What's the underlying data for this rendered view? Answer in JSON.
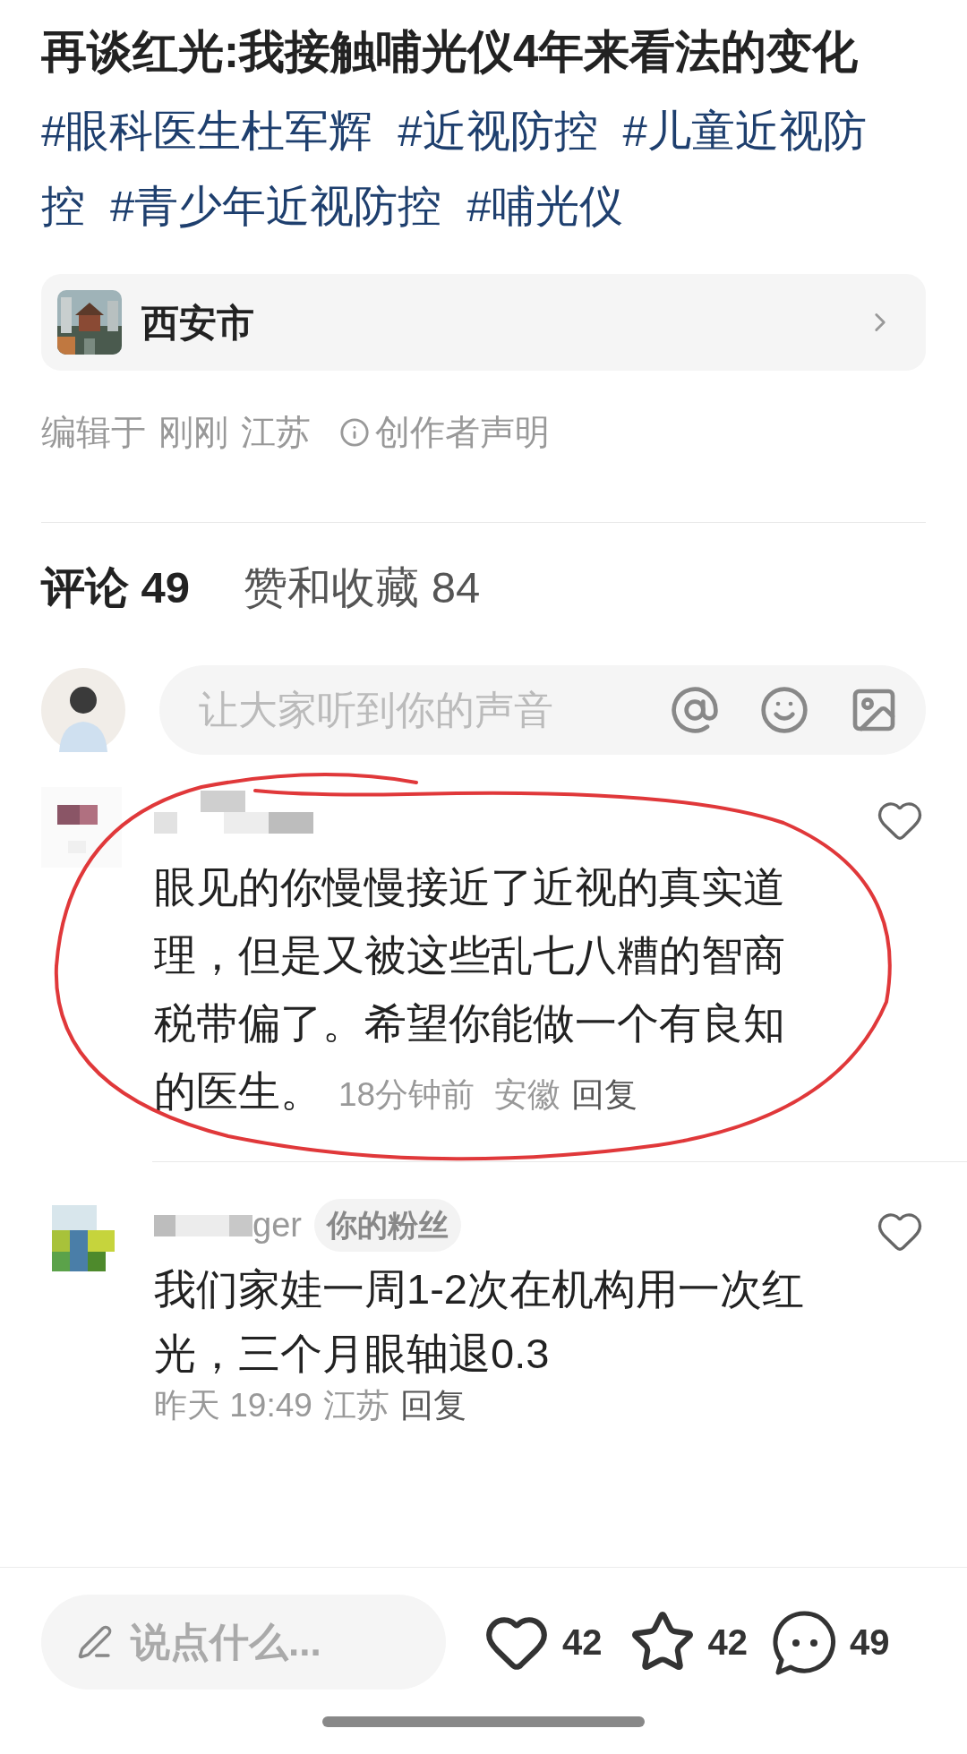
{
  "post": {
    "title": "再谈红光:我接触哺光仪4年来看法的变化",
    "tags": [
      "#眼科医生杜军辉",
      "#近视防控",
      "#儿童近视防控",
      "#青少年近视防控",
      "#哺光仪"
    ]
  },
  "location": {
    "name": "西安市"
  },
  "meta": {
    "edited": "编辑于",
    "time": "刚刚",
    "region": "江苏",
    "statement": "创作者声明"
  },
  "tabs": [
    {
      "label": "评论 49",
      "selected": true
    },
    {
      "label": "赞和收藏 84",
      "selected": false
    }
  ],
  "comment_input": {
    "placeholder": "让大家听到你的声音"
  },
  "comments": [
    {
      "text": "眼见的你慢慢接近了近视的真实道理，但是又被这些乱七八糟的智商税带偏了。希望你能做一个有良知的医生。",
      "time": "18分钟前",
      "region": "安徽",
      "reply": "回复",
      "liked": false,
      "annotated": true
    },
    {
      "name": "ger",
      "badge": "你的粉丝",
      "text": "我们家娃一周1-2次在机构用一次红光，三个月眼轴退0.3",
      "time": "昨天 19:49",
      "region": "江苏",
      "reply": "回复",
      "liked": false,
      "annotated": false
    }
  ],
  "bottom_bar": {
    "placeholder": "说点什么...",
    "likes": "42",
    "liked": false,
    "favorites": "42",
    "favorited": false,
    "comments": "49"
  }
}
